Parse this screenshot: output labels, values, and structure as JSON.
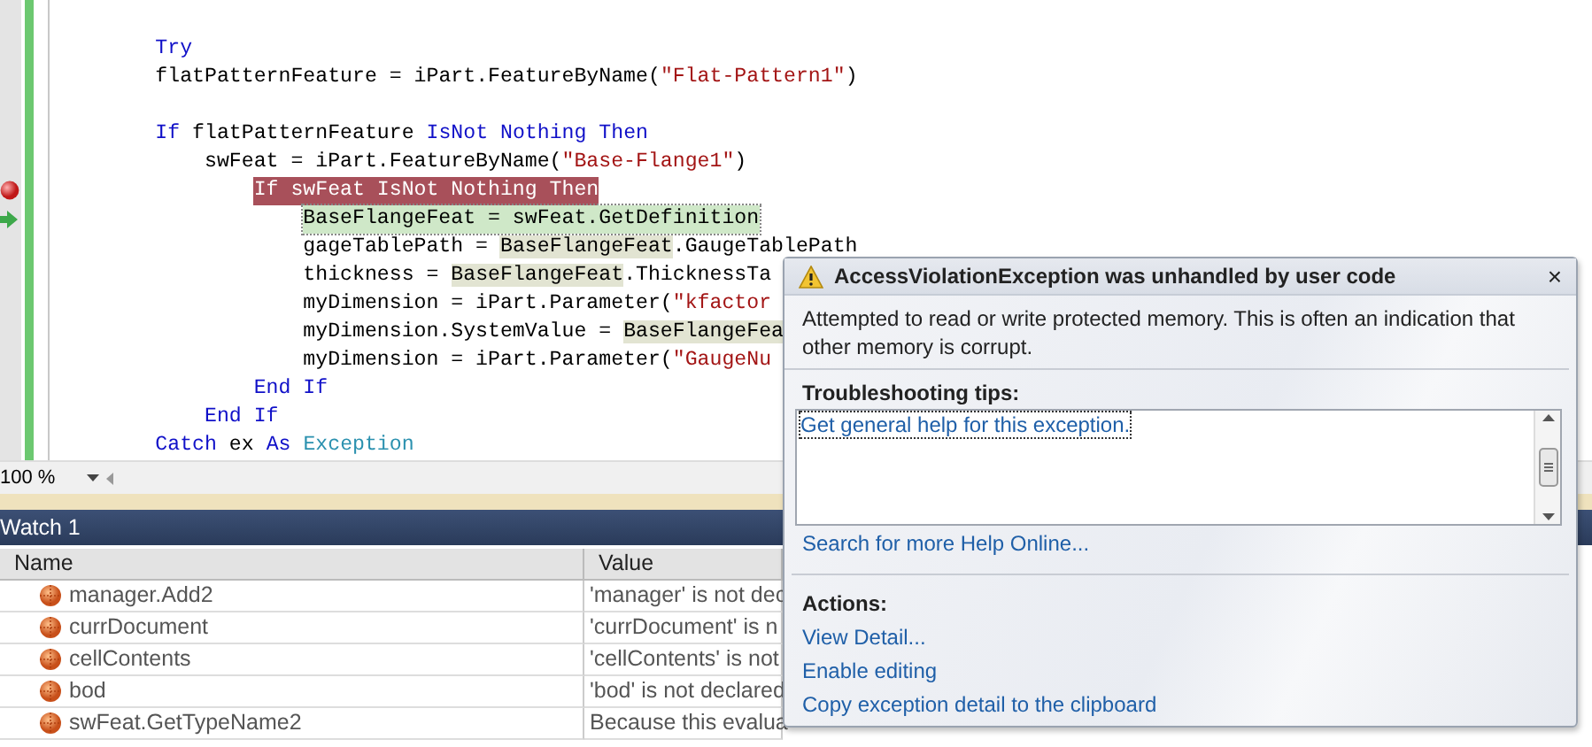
{
  "editor": {
    "lines": [
      {
        "breakpoint": false,
        "current": false,
        "tokens": [
          {
            "kind": "keyword",
            "text": "        Try"
          }
        ]
      },
      {
        "breakpoint": false,
        "current": false,
        "tokens": [
          {
            "kind": "plain",
            "text": "        flatPatternFeature = iPart.FeatureByName("
          },
          {
            "kind": "string",
            "text": "\"Flat-Pattern1\""
          },
          {
            "kind": "plain",
            "text": ")"
          }
        ]
      },
      {
        "breakpoint": false,
        "current": false
      },
      {
        "breakpoint": false,
        "current": false,
        "tokens": [
          {
            "kind": "keyword",
            "text": "        If"
          },
          {
            "kind": "plain",
            "text": " flatPatternFeature "
          },
          {
            "kind": "keyword",
            "text": "IsNot Nothing Then"
          }
        ]
      },
      {
        "breakpoint": false,
        "current": false,
        "tokens": [
          {
            "kind": "plain",
            "text": "            swFeat = iPart.FeatureByName("
          },
          {
            "kind": "string",
            "text": "\"Base-Flange1\""
          },
          {
            "kind": "plain",
            "text": ")"
          }
        ]
      },
      {
        "breakpoint": true,
        "current": false,
        "tokens": [
          {
            "kind": "plain",
            "text": "                If swFeat IsNot Nothing Then"
          }
        ]
      },
      {
        "breakpoint": false,
        "current": true,
        "tokens": [
          {
            "kind": "plain",
            "text": "                    BaseFlangeFeat = swFeat.GetDefinition"
          }
        ]
      },
      {
        "breakpoint": false,
        "current": false,
        "tokens": [
          {
            "kind": "plain",
            "text": "                    gageTablePath = "
          },
          {
            "kind": "ref",
            "text": "BaseFlangeFeat"
          },
          {
            "kind": "plain",
            "text": ".GaugeTablePath"
          }
        ]
      },
      {
        "breakpoint": false,
        "current": false,
        "tokens": [
          {
            "kind": "plain",
            "text": "                    thickness = "
          },
          {
            "kind": "ref",
            "text": "BaseFlangeFeat"
          },
          {
            "kind": "plain",
            "text": ".ThicknessTa"
          }
        ]
      },
      {
        "breakpoint": false,
        "current": false,
        "tokens": [
          {
            "kind": "plain",
            "text": "                    myDimension = iPart.Parameter("
          },
          {
            "kind": "string",
            "text": "\"kfactor"
          }
        ]
      },
      {
        "breakpoint": false,
        "current": false,
        "tokens": [
          {
            "kind": "plain",
            "text": "                    myDimension.SystemValue = "
          },
          {
            "kind": "ref",
            "text": "BaseFlangeFea"
          }
        ]
      },
      {
        "breakpoint": false,
        "current": false,
        "tokens": [
          {
            "kind": "plain",
            "text": "                    myDimension = iPart.Parameter("
          },
          {
            "kind": "string",
            "text": "\"GaugeNu"
          }
        ]
      },
      {
        "breakpoint": false,
        "current": false,
        "tokens": [
          {
            "kind": "keyword",
            "text": "                End If"
          }
        ]
      },
      {
        "breakpoint": false,
        "current": false,
        "tokens": [
          {
            "kind": "keyword",
            "text": "            End If"
          }
        ]
      },
      {
        "breakpoint": false,
        "current": false,
        "tokens": [
          {
            "kind": "keyword",
            "text": "        Catch"
          },
          {
            "kind": "plain",
            "text": " ex "
          },
          {
            "kind": "keyword",
            "text": "As"
          },
          {
            "kind": "type",
            "text": " Exception"
          }
        ]
      }
    ]
  },
  "zoom": {
    "value": "100 %"
  },
  "watch": {
    "title": "Watch 1",
    "columns": [
      "Name",
      "Value"
    ],
    "rows": [
      {
        "name": "manager.Add2",
        "value": "'manager' is not dec"
      },
      {
        "name": "currDocument",
        "value": "'currDocument' is n"
      },
      {
        "name": "cellContents",
        "value": "'cellContents' is not"
      },
      {
        "name": "bod",
        "value": "'bod' is not declared"
      },
      {
        "name": "swFeat.GetTypeName2",
        "value": "Because this evalua"
      }
    ]
  },
  "exception_popup": {
    "title": "AccessViolationException was unhandled by user code",
    "close": "×",
    "message": "Attempted to read or write protected memory. This is often an indication that other memory is corrupt.",
    "tips_heading": "Troubleshooting tips:",
    "tips": [
      "Get general help for this exception."
    ],
    "search_link": "Search for more Help Online...",
    "actions_heading": "Actions:",
    "actions": [
      "View Detail...",
      "Enable editing",
      "Copy exception detail to the clipboard"
    ]
  }
}
